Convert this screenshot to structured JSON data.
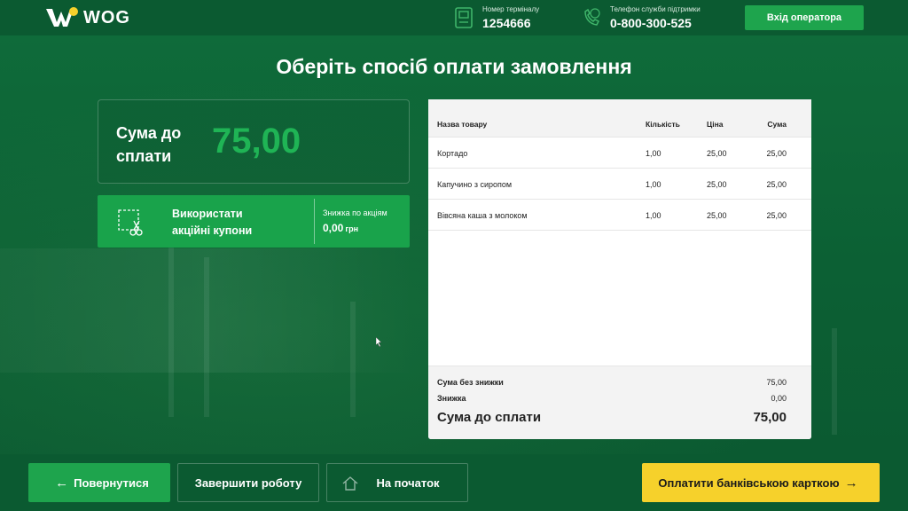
{
  "header": {
    "brand": "WOG",
    "terminal_label": "Номер терміналу",
    "terminal_value": "1254666",
    "phone_label": "Телефон служби підтримки",
    "phone_value": "0-800-300-525",
    "operator_button": "Вхід оператора"
  },
  "title": "Оберіть спосіб оплати замовлення",
  "summary": {
    "label": "Сума до сплати",
    "value": "75,00"
  },
  "coupon": {
    "label_line1": "Використати",
    "label_line2": "акційні купони",
    "discount_label": "Знижка по акціям",
    "discount_value": "0,00",
    "discount_currency": "грн"
  },
  "receipt": {
    "columns": [
      "Назва товару",
      "Кількість",
      "Ціна",
      "Сума"
    ],
    "rows": [
      [
        "Кортадо",
        "1,00",
        "25,00",
        "25,00"
      ],
      [
        "Капучино з сиропом",
        "1,00",
        "25,00",
        "25,00"
      ],
      [
        "Вівсяна каша з молоком",
        "1,00",
        "25,00",
        "25,00"
      ]
    ],
    "subtotal_label": "Сума без знижки",
    "subtotal_value": "75,00",
    "discount_label": "Знижка",
    "discount_value": "0,00",
    "total_label": "Сума до сплати",
    "total_value": "75,00"
  },
  "footer": {
    "back_button": "Повернутися",
    "finish_button": "Завершити роботу",
    "home_button": "На початок",
    "pay_button": "Оплатити банківською карткою"
  },
  "colors": {
    "brand_green": "#0b5a31",
    "accent_green": "#1ea44d",
    "amount_green": "#1fb455",
    "pay_yellow": "#f6d12b"
  },
  "icons": [
    "wog-logo-icon",
    "terminal-icon",
    "phone-icon",
    "coupon-scissors-icon",
    "home-icon",
    "arrow-left-icon",
    "arrow-right-icon"
  ]
}
